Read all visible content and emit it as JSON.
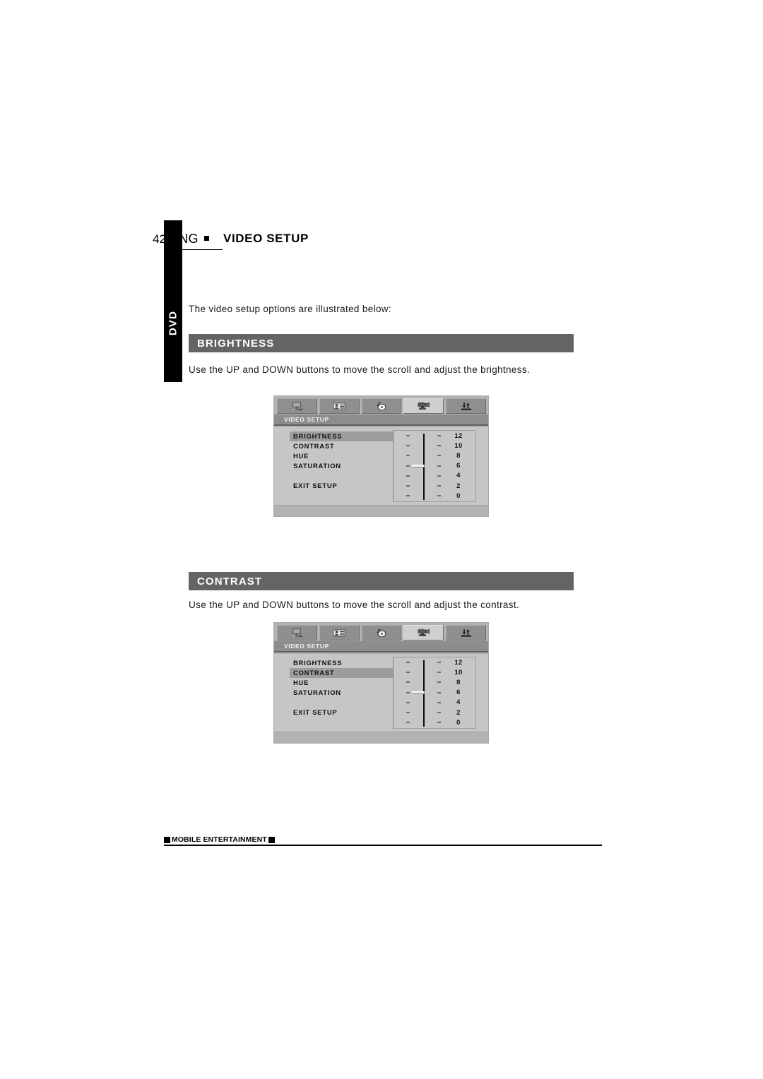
{
  "page": {
    "number": "42",
    "language": "ENG",
    "title": "VIDEO SETUP",
    "side_tab": "DVD",
    "intro": "The video setup options are illustrated below:"
  },
  "sections": [
    {
      "heading": "BRIGHTNESS",
      "instruction": "Use the UP and DOWN buttons to move the scroll and adjust the brightness."
    },
    {
      "heading": "CONTRAST",
      "instruction": "Use the UP and DOWN buttons to move the scroll and adjust the contrast."
    }
  ],
  "osd": {
    "subtitle": "VIDEO SETUP",
    "tabs": [
      {
        "icon": "monitor-icon",
        "label": "General Setup"
      },
      {
        "icon": "speaker-id-icon",
        "label": "Speaker Setup"
      },
      {
        "icon": "audio-disc-icon",
        "label": "Audio Setup"
      },
      {
        "icon": "video-camera-icon",
        "label": "Video Setup"
      },
      {
        "icon": "updown-arrows-icon",
        "label": "Preference Setup"
      }
    ],
    "active_tab_index": 3,
    "menu_items": [
      "BRIGHTNESS",
      "CONTRAST",
      "HUE",
      "SATURATION",
      "EXIT SETUP"
    ],
    "scale_values": [
      "12",
      "10",
      "8",
      "6",
      "4",
      "2",
      "0"
    ],
    "thumb_row_index": 3,
    "screen_1_selected": "BRIGHTNESS",
    "screen_2_selected": "CONTRAST",
    "colors": {
      "panel": "#c6c6c6",
      "frame": "#b2b2b2",
      "tab": "#8f8f8f",
      "tab_active": "#cfcfcf",
      "subbar": "#8d8d8d",
      "highlight": "#9d9d9d"
    }
  },
  "footer": {
    "text": "MOBILE ENTERTAINMENT"
  },
  "theme": {
    "bar_bg": "#646464",
    "bar_text": "#ffffff",
    "side_tab_bg": "#000000"
  }
}
